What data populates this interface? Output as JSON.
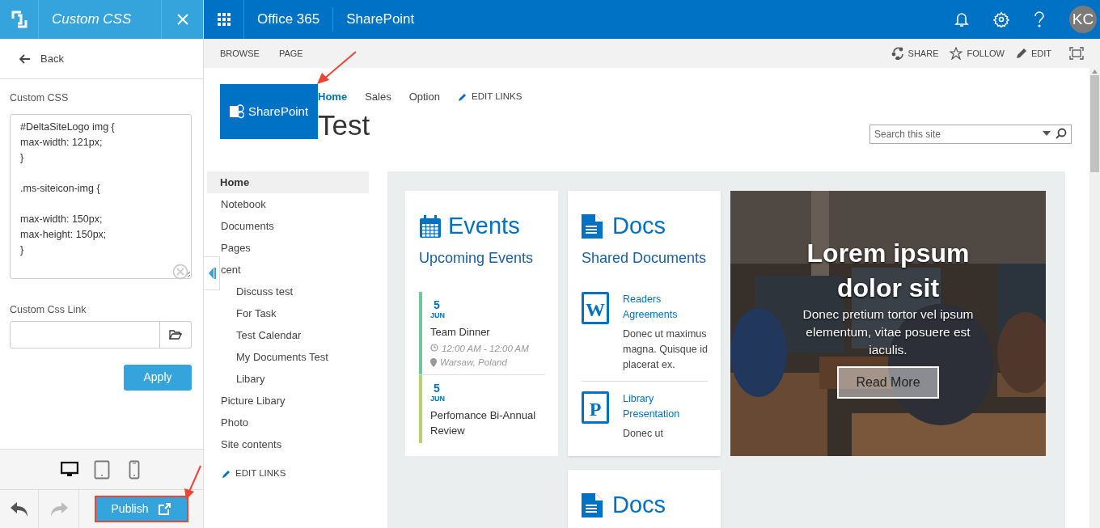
{
  "panel": {
    "title": "Custom CSS",
    "back": "Back",
    "css_label": "Custom CSS",
    "css_value": "#DeltaSiteLogo img {\nmax-width: 121px;\n}\n\n.ms-siteicon-img {\n\nmax-width: 150px;\nmax-height: 150px;\n}",
    "link_label": "Custom Css Link",
    "apply": "Apply",
    "devices": [
      {
        "kind": "desktop",
        "selected": true
      },
      {
        "kind": "tablet",
        "selected": false
      },
      {
        "kind": "phone",
        "selected": false
      }
    ],
    "undo_disabled": false,
    "redo_disabled": true,
    "publish": "Publish"
  },
  "suite_bar": {
    "app": "Office 365",
    "site": "SharePoint",
    "avatar": "KC"
  },
  "ribbon": {
    "tabs": [
      "BROWSE",
      "PAGE"
    ],
    "actions": [
      {
        "kind": "share",
        "label": "SHARE"
      },
      {
        "kind": "follow",
        "label": "FOLLOW"
      },
      {
        "kind": "edit",
        "label": "EDIT"
      }
    ]
  },
  "site": {
    "logo": "SharePoint",
    "top_nav": [
      {
        "label": "Home",
        "selected": true
      },
      {
        "label": "Sales",
        "selected": false
      },
      {
        "label": "Option",
        "selected": false
      }
    ],
    "edit_links": "EDIT LINKS",
    "title": "Test",
    "search_placeholder": "Search this site"
  },
  "quick_launch": {
    "items": [
      {
        "label": "Home",
        "selected": true
      },
      {
        "label": "Notebook",
        "selected": false
      },
      {
        "label": "Documents",
        "selected": false
      },
      {
        "label": "Pages",
        "selected": false
      },
      {
        "label": "cent",
        "selected": false,
        "children": [
          {
            "label": "Discuss test",
            "selected": false
          },
          {
            "label": "For Task",
            "selected": false
          },
          {
            "label": "Test Calendar",
            "selected": false
          },
          {
            "label": "My Documents Test",
            "selected": false
          },
          {
            "label": "Libary",
            "selected": false
          }
        ]
      },
      {
        "label": "Picture Libary",
        "selected": false
      },
      {
        "label": "Photo",
        "selected": false
      },
      {
        "label": "Site contents",
        "selected": false
      }
    ],
    "edit_links": "EDIT LINKS"
  },
  "events": {
    "title": "Events",
    "subtitle": "Upcoming Events",
    "items": [
      {
        "day": "5",
        "month": "JUN",
        "name": "Team Dinner",
        "time": "12:00 AM - 12:00 AM",
        "place": "Warsaw, Poland",
        "color": "#6cc99a"
      },
      {
        "day": "5",
        "month": "JUN",
        "name": "Perfomance Bi-Annual Review",
        "color": "#b5d36b"
      }
    ]
  },
  "docs": {
    "title": "Docs",
    "subtitle": "Shared Documents",
    "items": [
      {
        "letter": "W",
        "name": "Readers Agreements",
        "text": "Donec ut maximus magna. Quisque id placerat ex."
      },
      {
        "letter": "P",
        "name": "Library Presentation",
        "text": "Donec ut"
      }
    ]
  },
  "hero": {
    "title": "Lorem ipsum dolor sit",
    "text": "Donec pretium tortor vel ipsum elementum, vitae posuere est iaculis.",
    "button": "Read More"
  },
  "docs_2": {
    "title": "Docs"
  }
}
